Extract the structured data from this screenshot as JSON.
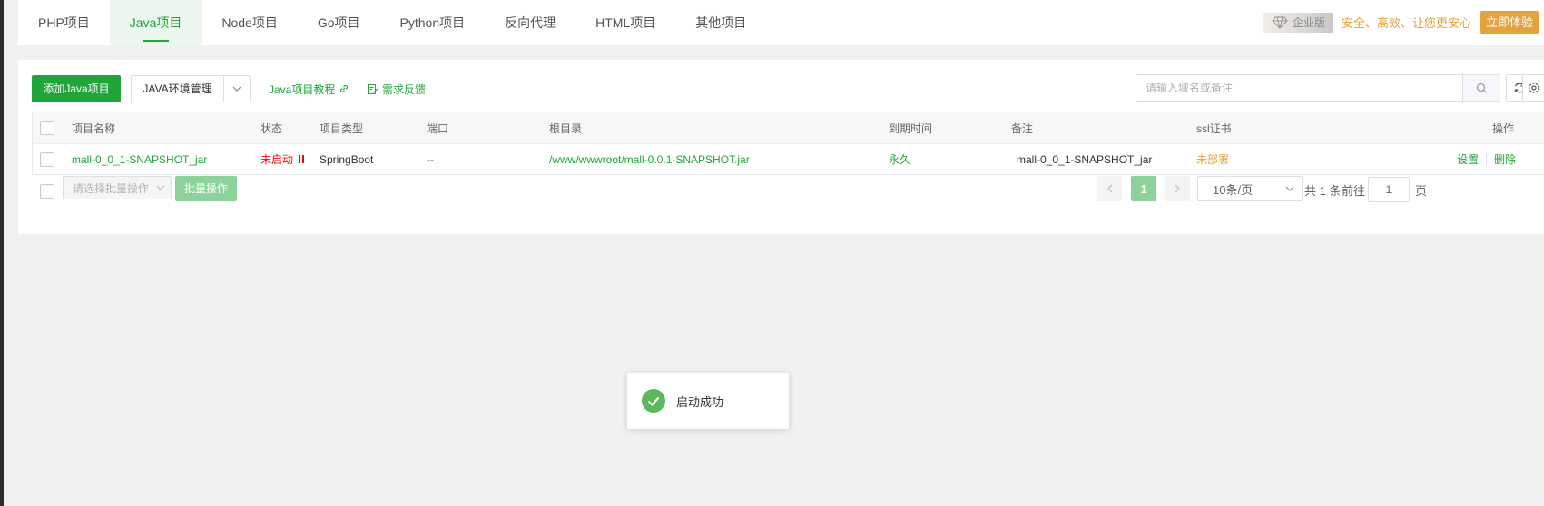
{
  "tabs": [
    {
      "label": "PHP项目",
      "active": false
    },
    {
      "label": "Java项目",
      "active": true
    },
    {
      "label": "Node项目",
      "active": false
    },
    {
      "label": "Go项目",
      "active": false
    },
    {
      "label": "Python项目",
      "active": false
    },
    {
      "label": "反向代理",
      "active": false
    },
    {
      "label": "HTML项目",
      "active": false
    },
    {
      "label": "其他项目",
      "active": false
    }
  ],
  "promo": {
    "badge": "企业版",
    "slogan": "安全、高效、让您更安心",
    "try_label": "立即体验"
  },
  "toolbar": {
    "add_label": "添加Java项目",
    "env_label": "JAVA环境管理",
    "tutorial_label": "Java项目教程",
    "feedback_label": "需求反馈"
  },
  "search": {
    "placeholder": "请输入域名或备注",
    "value": ""
  },
  "table": {
    "headers": {
      "name": "项目名称",
      "status": "状态",
      "type": "项目类型",
      "port": "端口",
      "root": "根目录",
      "expire": "到期时间",
      "remark": "备注",
      "ssl": "ssl证书",
      "action": "操作"
    },
    "rows": [
      {
        "name": "mall-0_0_1-SNAPSHOT_jar",
        "status": "未启动",
        "type": "SpringBoot",
        "port": "--",
        "root": "/www/wwwroot/mall-0.0.1-SNAPSHOT.jar",
        "expire": "永久",
        "remark": "mall-0_0_1-SNAPSHOT_jar",
        "ssl": "未部署",
        "action_settings": "设置",
        "action_delete": "删除"
      }
    ]
  },
  "footer": {
    "batch_placeholder": "请选择批量操作",
    "batch_button": "批量操作",
    "current_page": "1",
    "per_page": "10条/页",
    "total": "共 1 条",
    "goto_label": "前往",
    "goto_value": "1",
    "page_suffix": "页"
  },
  "toast": {
    "message": "启动成功"
  },
  "colors": {
    "accent": "#20a53a",
    "stopped": "#ef0808",
    "warning": "#e6a23c"
  }
}
